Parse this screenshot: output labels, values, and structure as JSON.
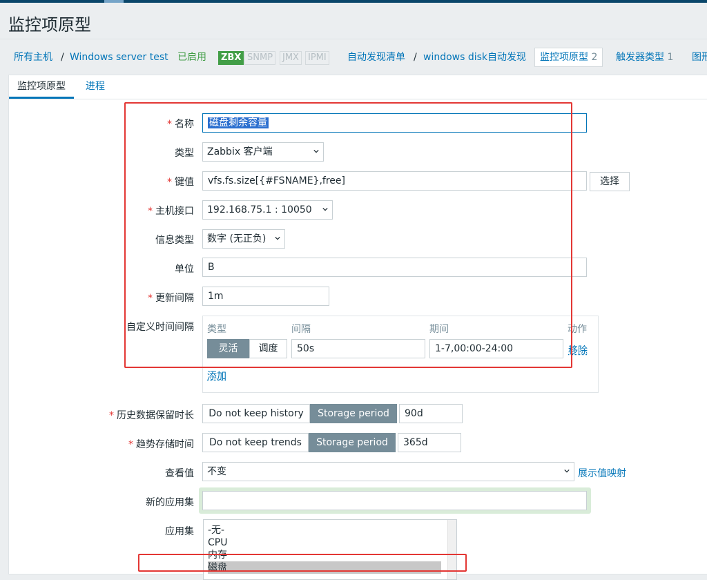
{
  "page": {
    "title": "监控项原型"
  },
  "breadcrumb": {
    "all_hosts": "所有主机",
    "sep": "/",
    "host": "Windows server test",
    "status": "已启用",
    "tags": [
      "ZBX",
      "SNMP",
      "JMX",
      "IPMI"
    ],
    "discovery_list": "自动发现清单",
    "discovery_rule": "windows disk自动发现",
    "item_prototypes": "监控项原型",
    "item_prototypes_count": "2",
    "trigger_prototypes": "触发器类型",
    "trigger_prototypes_count": "1",
    "graph_prototypes": "图形"
  },
  "tabs": {
    "item": "监控项原型",
    "process": "进程"
  },
  "form": {
    "name_label": "名称",
    "name_value": "磁盘剩余容量",
    "type_label": "类型",
    "type_value": "Zabbix 客户端",
    "key_label": "键值",
    "key_value": "vfs.fs.size[{#FSNAME},free]",
    "select_btn": "选择",
    "interface_label": "主机接口",
    "interface_value": "192.168.75.1 : 10050",
    "info_type_label": "信息类型",
    "info_type_value": "数字 (无正负)",
    "units_label": "单位",
    "units_value": "B",
    "interval_label": "更新间隔",
    "interval_value": "1m",
    "custom_intervals_label": "自定义时间间隔",
    "ci_headers": {
      "type": "类型",
      "interval": "间隔",
      "period": "期间",
      "action": "动作"
    },
    "ci_row": {
      "flexible": "灵活",
      "scheduling": "调度",
      "interval": "50s",
      "period": "1-7,00:00-24:00",
      "remove": "移除"
    },
    "add": "添加",
    "history_label": "历史数据保留时长",
    "history_no_keep": "Do not keep history",
    "history_storage": "Storage period",
    "history_value": "90d",
    "trends_label": "趋势存储时间",
    "trends_no_keep": "Do not keep trends",
    "trends_storage": "Storage period",
    "trends_value": "365d",
    "valuemap_label": "查看值",
    "valuemap_value": "不变",
    "valuemap_link": "展示值映射",
    "new_app_label": "新的应用集",
    "new_app_value": "",
    "apps_label": "应用集",
    "apps": [
      "-无-",
      "CPU",
      "内存",
      "磁盘"
    ]
  }
}
